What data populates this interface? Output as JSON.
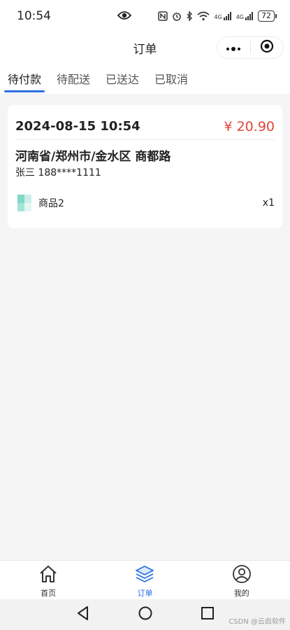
{
  "status_bar": {
    "time": "10:54",
    "battery": "72",
    "network_label_1": "4G",
    "network_label_2": "4G"
  },
  "nav": {
    "title": "订单"
  },
  "tabs": [
    {
      "label": "待付款",
      "active": true
    },
    {
      "label": "待配送",
      "active": false
    },
    {
      "label": "已送达",
      "active": false
    },
    {
      "label": "已取消",
      "active": false
    }
  ],
  "order": {
    "time": "2024-08-15 10:54",
    "price": "¥ 20.90",
    "address": "河南省/郑州市/金水区 商都路",
    "contact": "张三 188****1111",
    "item": {
      "name": "商品2",
      "quantity": "x1",
      "thumb_colors": [
        "#7fd8c8",
        "#cdeee8",
        "#a5e3d6",
        "#e4f6f2"
      ]
    }
  },
  "tabbar": [
    {
      "label": "首页",
      "icon": "home-icon",
      "active": false
    },
    {
      "label": "订单",
      "icon": "layers-icon",
      "active": true
    },
    {
      "label": "我的",
      "icon": "user-icon",
      "active": false
    }
  ],
  "colors": {
    "accent": "#2b6fe0",
    "price": "#e0473b"
  },
  "watermark": "CSDN @云启软件"
}
